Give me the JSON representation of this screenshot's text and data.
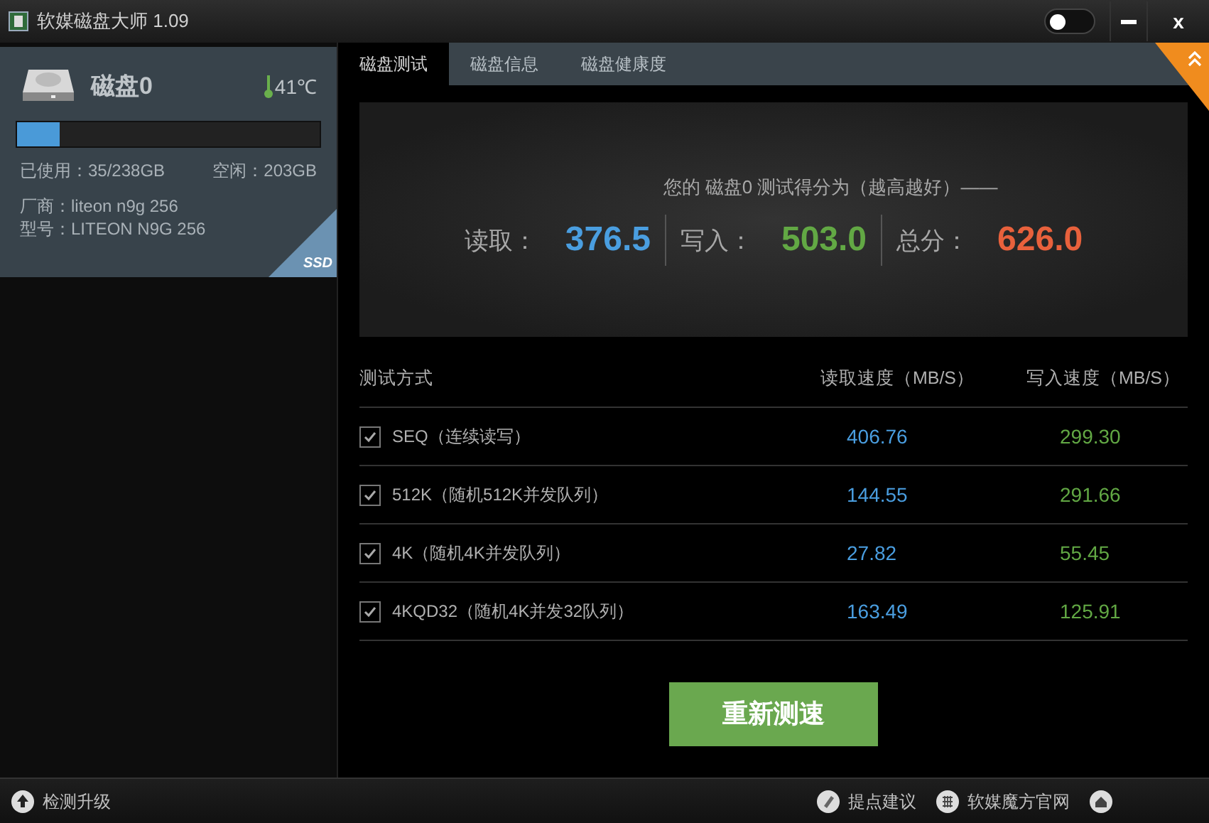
{
  "window": {
    "title": "软媒磁盘大师 1.09",
    "close": "x",
    "night_mode": {
      "on": false
    }
  },
  "disk": {
    "name": "磁盘0",
    "temperature": "41℃",
    "usage": {
      "level": 0.14
    },
    "used": "已使用：35/238GB",
    "free": "空闲：203GB",
    "vendor": "厂商：liteon n9g  256",
    "model": "型号：LITEON N9G  256",
    "badge": "SSD"
  },
  "tabs": [
    {
      "label": "磁盘测试",
      "selected": true
    },
    {
      "label": "磁盘信息",
      "selected": false
    },
    {
      "label": "磁盘健康度",
      "selected": false
    }
  ],
  "score": {
    "caption": "您的 磁盘0 测试得分为（越高越好）——",
    "items": [
      {
        "label": "读取：",
        "value": "376.5",
        "color": "#4a9ee0"
      },
      {
        "label": "写入：",
        "value": "503.0",
        "color": "#62a844"
      },
      {
        "label": "总分：",
        "value": "626.0",
        "color": "#e8613c"
      }
    ]
  },
  "table": {
    "columns": [
      "测试方式",
      "读取速度（MB/S）",
      "写入速度（MB/S）"
    ],
    "rows": [
      {
        "name": "SEQ（连续读写）",
        "checked": true,
        "read": "406.76",
        "write": "299.30"
      },
      {
        "name": "512K（随机512K并发队列）",
        "checked": true,
        "read": "144.55",
        "write": "291.66"
      },
      {
        "name": "4K（随机4K并发队列）",
        "checked": true,
        "read": "27.82",
        "write": "55.45"
      },
      {
        "name": "4KQD32（随机4K并发32队列）",
        "checked": true,
        "read": "163.49",
        "write": "125.91"
      }
    ]
  },
  "retest_button": "重新测速",
  "status_bar": {
    "update": "检测升级",
    "links": [
      "提点建议",
      "软媒魔方官网"
    ]
  }
}
